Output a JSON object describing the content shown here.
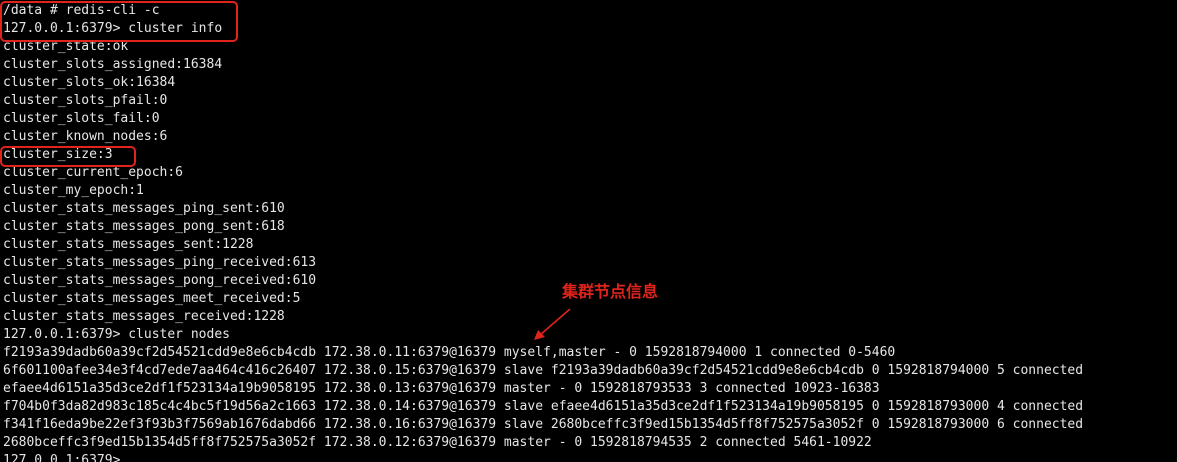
{
  "terminal": {
    "lines": [
      "/data # redis-cli -c",
      "127.0.0.1:6379> cluster info",
      "cluster_state:ok",
      "cluster_slots_assigned:16384",
      "cluster_slots_ok:16384",
      "cluster_slots_pfail:0",
      "cluster_slots_fail:0",
      "cluster_known_nodes:6",
      "cluster_size:3",
      "cluster_current_epoch:6",
      "cluster_my_epoch:1",
      "cluster_stats_messages_ping_sent:610",
      "cluster_stats_messages_pong_sent:618",
      "cluster_stats_messages_sent:1228",
      "cluster_stats_messages_ping_received:613",
      "cluster_stats_messages_pong_received:610",
      "cluster_stats_messages_meet_received:5",
      "cluster_stats_messages_received:1228",
      "127.0.0.1:6379> cluster nodes",
      "f2193a39dadb60a39cf2d54521cdd9e8e6cb4cdb 172.38.0.11:6379@16379 myself,master - 0 1592818794000 1 connected 0-5460",
      "6f601100afee34e3f4cd7ede7aa464c416c26407 172.38.0.15:6379@16379 slave f2193a39dadb60a39cf2d54521cdd9e8e6cb4cdb 0 1592818794000 5 connected",
      "efaee4d6151a35d3ce2df1f523134a19b9058195 172.38.0.13:6379@16379 master - 0 1592818793533 3 connected 10923-16383",
      "f704b0f3da82d983c185c4c4bc5f19d56a2c1663 172.38.0.14:6379@16379 slave efaee4d6151a35d3ce2df1f523134a19b9058195 0 1592818793000 4 connected",
      "f341f16eda9be22ef3f93b3f7569ab1676dabd66 172.38.0.16:6379@16379 slave 2680bceffc3f9ed15b1354d5ff8f752575a3052f 0 1592818793000 6 connected",
      "2680bceffc3f9ed15b1354d5ff8f752575a3052f 172.38.0.12:6379@16379 master - 0 1592818794535 2 connected 5461-10922",
      "127.0.0.1:6379>"
    ]
  },
  "annotation": {
    "label": "集群节点信息"
  },
  "colors": {
    "background": "#000000",
    "text": "#e6e6e6",
    "highlight": "#e0231b"
  }
}
